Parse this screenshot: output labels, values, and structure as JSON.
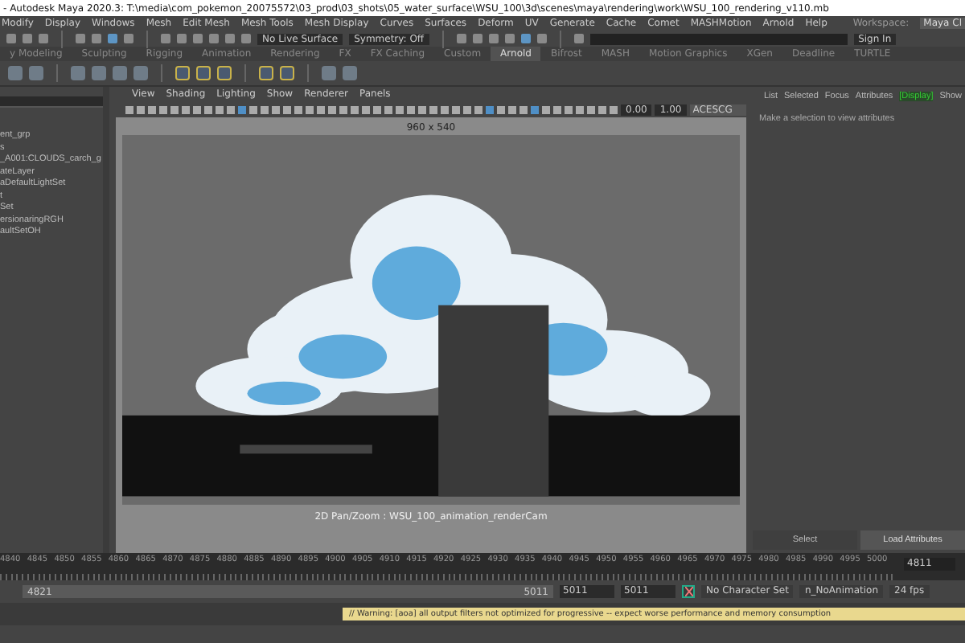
{
  "window": {
    "title": "- Autodesk Maya 2020.3: T:\\media\\com_pokemon_20075572\\03_prod\\03_shots\\05_water_surface\\WSU_100\\3d\\scenes\\maya\\rendering\\work\\WSU_100_rendering_v110.mb"
  },
  "menu_bar": {
    "items": [
      "Modify",
      "Display",
      "Windows",
      "Mesh",
      "Edit Mesh",
      "Mesh Tools",
      "Mesh Display",
      "Curves",
      "Surfaces",
      "Deform",
      "UV",
      "Generate",
      "Cache",
      "Comet",
      "MASHMotion",
      "Arnold",
      "Help"
    ],
    "workspace_label": "Workspace:",
    "workspace_value": "Maya Cl"
  },
  "status_line": {
    "live_surface": "No Live Surface",
    "symmetry": "Symmetry: Off",
    "sign_in": "Sign In"
  },
  "shelf_tabs": [
    {
      "label": "y Modeling",
      "selected": false
    },
    {
      "label": "Sculpting",
      "selected": false
    },
    {
      "label": "Rigging",
      "selected": false
    },
    {
      "label": "Animation",
      "selected": false
    },
    {
      "label": "Rendering",
      "selected": false
    },
    {
      "label": "FX",
      "selected": false
    },
    {
      "label": "FX Caching",
      "selected": false
    },
    {
      "label": "Custom",
      "selected": false
    },
    {
      "label": "Arnold",
      "selected": true
    },
    {
      "label": "Bifrost",
      "selected": false
    },
    {
      "label": "MASH",
      "selected": false
    },
    {
      "label": "Motion Graphics",
      "selected": false
    },
    {
      "label": "XGen",
      "selected": false
    },
    {
      "label": "Deadline",
      "selected": false
    },
    {
      "label": "TURTLE",
      "selected": false
    }
  ],
  "outliner": {
    "items": [
      "ent_grp",
      "s",
      "_A001:CLOUDS_carch_g",
      "ateLayer",
      "aDefaultLightSet",
      "t",
      "Set",
      "ersionaringRGH",
      "aultSetOH"
    ]
  },
  "viewport": {
    "menu": [
      "View",
      "Shading",
      "Lighting",
      "Show",
      "Renderer",
      "Panels"
    ],
    "exposure": "0.00",
    "gamma": "1.00",
    "color_space": "ACESCG",
    "resolution": "960 x 540",
    "camera_label": "2D Pan/Zoom : WSU_100_animation_renderCam"
  },
  "attribute_editor": {
    "tabs": [
      {
        "label": "List",
        "selected": false
      },
      {
        "label": "Selected",
        "selected": false
      },
      {
        "label": "Focus",
        "selected": false
      },
      {
        "label": "Attributes",
        "selected": false
      },
      {
        "label": "[Display]",
        "selected": true
      },
      {
        "label": "Show",
        "selected": false
      }
    ],
    "message": "Make a selection to view attributes",
    "buttons": [
      "Select",
      "Load Attributes"
    ]
  },
  "timeline": {
    "ticks": [
      "4840",
      "4845",
      "4850",
      "4855",
      "4860",
      "4865",
      "4870",
      "4875",
      "4880",
      "4885",
      "4890",
      "4895",
      "4900",
      "4905",
      "4910",
      "4915",
      "4920",
      "4925",
      "4930",
      "4935",
      "4940",
      "4945",
      "4950",
      "4955",
      "4960",
      "4965",
      "4970",
      "4975",
      "4980",
      "4985",
      "4990",
      "4995",
      "5000"
    ],
    "current_frame": "4811"
  },
  "range_slider": {
    "start": "4821",
    "end": "5011",
    "range_start": "5011",
    "range_end": "5011",
    "character_set": "No Character Set",
    "anim_layer": "n_NoAnimation",
    "fps": "24 fps"
  },
  "help_line": {
    "warning": "// Warning: [aoa] all output filters not optimized for progressive -- expect worse performance and memory consumption"
  }
}
